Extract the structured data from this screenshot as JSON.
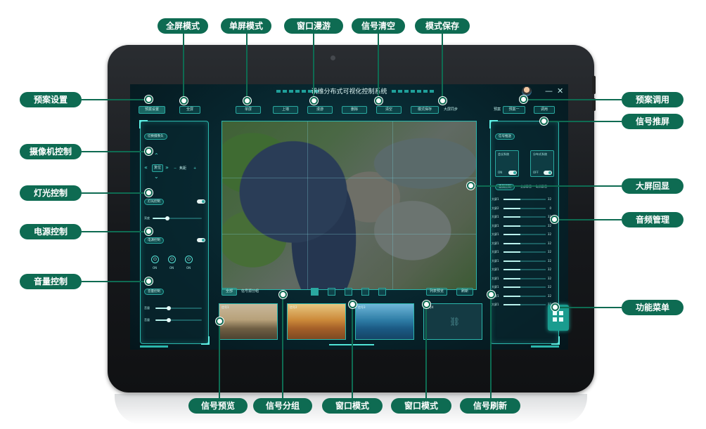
{
  "callouts": {
    "top": [
      "全屏模式",
      "单屏模式",
      "窗口漫游",
      "信号清空",
      "模式保存"
    ],
    "left": [
      "预案设置",
      "摄像机控制",
      "灯光控制",
      "电源控制",
      "音量控制"
    ],
    "right": [
      "预案调用",
      "信号推屏",
      "大屏回显",
      "音频管理",
      "功能菜单"
    ],
    "bottom": [
      "信号预览",
      "信号分组",
      "窗口模式",
      "窗口模式",
      "信号刷新"
    ]
  },
  "screen": {
    "title": "讯维分布式可视化控制系统",
    "window_controls": {
      "minimize": "—",
      "close": "✕"
    },
    "toolbar": {
      "plan_settings": "预案设置",
      "fullscreen": "全屏",
      "single_screen": "单屏",
      "upload": "上墙",
      "roam": "漫游",
      "delete": "删除",
      "clear": "清空",
      "mode_save": "模式保存",
      "big_screen_sync": "大屏同步",
      "plan_label": "预案",
      "plan_select": "预案一",
      "call": "调用"
    },
    "left_panel": {
      "camera_btn": "切换摄像头",
      "reset": "复位",
      "focus": "焦距",
      "light_btn": "灯光控制",
      "brightness": "亮度",
      "power_btn": "电源控制",
      "power_states": [
        "ON",
        "ON",
        "ON"
      ],
      "volume_btn": "音量控制",
      "volume_rows": [
        "音量",
        "音量"
      ]
    },
    "bottom_bar": {
      "tabs": [
        "全部",
        "信号源分组"
      ],
      "list_preview": "列表预览",
      "refresh": "刷新",
      "thumb_labels": [
        "信号1",
        "信号2",
        "信号3",
        "信号4"
      ]
    },
    "right_panel": {
      "push_btn": "信号推送",
      "systems": [
        {
          "name": "会议系统",
          "state": "ON"
        },
        {
          "name": "分布式系统",
          "state": "OFF"
        }
      ],
      "audio_tabs": [
        "音频控制",
        "全部静音",
        "取消静音"
      ],
      "audio_rows": [
        {
          "label": "大屏1",
          "value": "32"
        },
        {
          "label": "大屏2",
          "value": "0"
        },
        {
          "label": "大屏1",
          "value": "32"
        },
        {
          "label": "大屏1",
          "value": "32"
        },
        {
          "label": "大屏1",
          "value": "32"
        },
        {
          "label": "大屏1",
          "value": "32"
        },
        {
          "label": "大屏1",
          "value": "32"
        },
        {
          "label": "大屏1",
          "value": "32"
        },
        {
          "label": "大屏1",
          "value": "32"
        },
        {
          "label": "大屏1",
          "value": "32"
        },
        {
          "label": "大屏1",
          "value": "32"
        },
        {
          "label": "大屏1",
          "value": "32"
        },
        {
          "label": "大屏1",
          "value": "32"
        }
      ]
    }
  },
  "colors": {
    "callout": "#0e6b52",
    "accent": "#2bb7ad",
    "screen_bg": "#07242c"
  },
  "icons": [
    "shield-icon",
    "fullscreen-icon",
    "monitor-icon",
    "roam-icon",
    "trash-icon",
    "clear-icon",
    "save-icon",
    "power-icon",
    "link-icon",
    "grid-menu-icon"
  ]
}
